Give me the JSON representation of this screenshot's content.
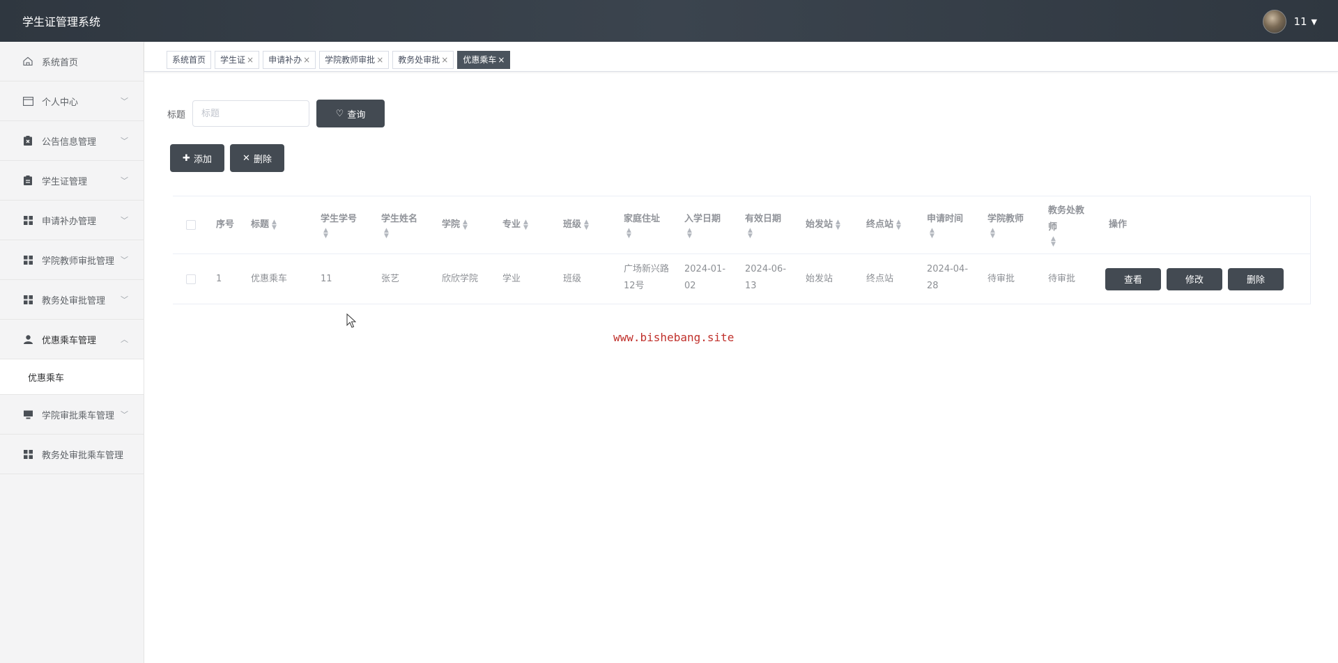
{
  "app": {
    "title": "学生证管理系统"
  },
  "user": {
    "name": "11",
    "caret": "▼"
  },
  "sidebar": {
    "items": [
      {
        "label": "系统首页",
        "icon": "home-icon",
        "chevron": ""
      },
      {
        "label": "个人中心",
        "icon": "card-icon",
        "chevron": "﹀"
      },
      {
        "label": "公告信息管理",
        "icon": "clipboard-x-icon",
        "chevron": "﹀"
      },
      {
        "label": "学生证管理",
        "icon": "clipboard-icon",
        "chevron": "﹀"
      },
      {
        "label": "申请补办管理",
        "icon": "grid-icon",
        "chevron": "﹀"
      },
      {
        "label": "学院教师审批管理",
        "icon": "grid-icon",
        "chevron": "﹀"
      },
      {
        "label": "教务处审批管理",
        "icon": "grid-icon",
        "chevron": "﹀"
      },
      {
        "label": "优惠乘车管理",
        "icon": "user-icon",
        "chevron": "︿"
      },
      {
        "label": "学院审批乘车管理",
        "icon": "monitor-icon",
        "chevron": "﹀"
      },
      {
        "label": "教务处审批乘车管理",
        "icon": "grid-icon",
        "chevron": ""
      }
    ],
    "submenu": {
      "label": "优惠乘车"
    }
  },
  "tabs": [
    {
      "label": "系统首页",
      "close": ""
    },
    {
      "label": "学生证",
      "close": "×"
    },
    {
      "label": "申请补办",
      "close": "×"
    },
    {
      "label": "学院教师审批",
      "close": "×"
    },
    {
      "label": "教务处审批",
      "close": "×"
    },
    {
      "label": "优惠乘车",
      "close": "×"
    }
  ],
  "search": {
    "label": "标题",
    "placeholder": "标题",
    "button_label": "查询",
    "button_icon": "♡"
  },
  "actions": {
    "add_label": "添加",
    "add_icon": "✚",
    "delete_label": "删除",
    "delete_icon": "✕"
  },
  "table": {
    "headers": [
      "序号",
      "标题",
      "学生学号",
      "学生姓名",
      "学院",
      "专业",
      "班级",
      "家庭住址",
      "入学日期",
      "有效日期",
      "始发站",
      "终点站",
      "申请时间",
      "学院教师",
      "教务处教师",
      "操作"
    ],
    "rows": [
      {
        "index": "1",
        "title": "优惠乘车",
        "student_no": "11",
        "student_name": "张艺",
        "college": "欣欣学院",
        "major": "学业",
        "class": "班级",
        "address": "广场新兴路12号",
        "enroll_date": "2024-01-02",
        "valid_date": "2024-06-13",
        "start_station": "始发站",
        "end_station": "终点站",
        "apply_time": "2024-04-28",
        "college_teacher": "待审批",
        "office_teacher": "待审批",
        "ops": {
          "view": "查看",
          "edit": "修改",
          "delete": "删除"
        }
      }
    ]
  },
  "watermark": "www.bishebang.site",
  "colors": {
    "topbar": "#343c45",
    "dark_button": "#434a52",
    "watermark": "#c0302b"
  }
}
